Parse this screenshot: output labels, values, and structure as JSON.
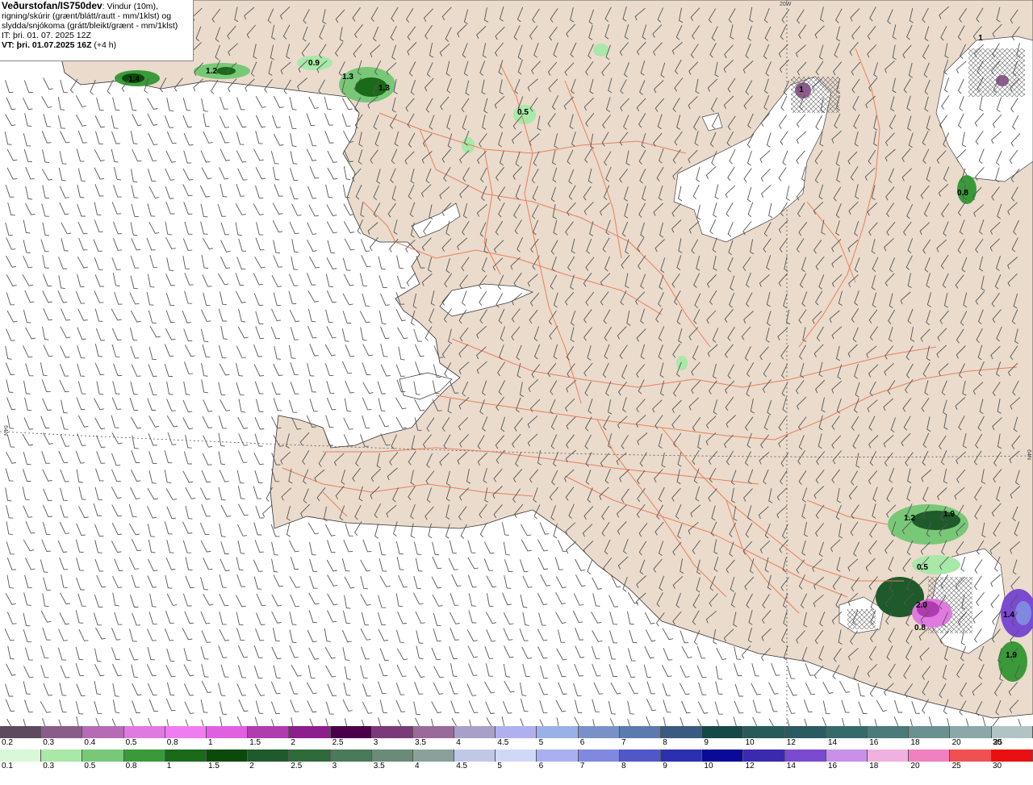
{
  "header": {
    "title": "Veðurstofan/IS750dev",
    "description_1": ": Vindur (10m),",
    "description_2": "rigning/skúrir (grænt/blátt/rautt - mm/1klst) og",
    "description_3": "slydda/snjókoma (grátt/bleikt/grænt - mm/1klst)",
    "initial_time": "IT: þri. 01. 07. 2025 12Z",
    "valid_time": "VT: þri. 01.07.2025 16Z",
    "lead_time": "(+4 h)"
  },
  "map": {
    "colors": {
      "land": "#eadbcc",
      "sea": "#ffffff",
      "roads": "#e8805a",
      "coast": "#333333",
      "barbs": "#555555",
      "glacier": "#ffffff"
    },
    "grid_labels": {
      "lon": "20W",
      "lat_left": "64N",
      "lat_right": "64N"
    },
    "precip_labels": [
      {
        "text": "1.4"
      },
      {
        "text": "1.2"
      },
      {
        "text": "0.9"
      },
      {
        "text": "1.3"
      },
      {
        "text": "1.3"
      },
      {
        "text": "0.5"
      },
      {
        "text": "1"
      },
      {
        "text": "0.8"
      },
      {
        "text": "1.2"
      },
      {
        "text": "1.9"
      },
      {
        "text": "0.5"
      },
      {
        "text": "2.0"
      },
      {
        "text": "0.8"
      },
      {
        "text": "1.9"
      },
      {
        "text": "1.4"
      },
      {
        "text": "1"
      }
    ]
  },
  "legend_snow": {
    "items": [
      {
        "label": "0.2",
        "color": "#5e4a5e"
      },
      {
        "label": "0.3",
        "color": "#8a5c8a"
      },
      {
        "label": "0.4",
        "color": "#b56cb5"
      },
      {
        "label": "0.5",
        "color": "#e07ae0"
      },
      {
        "label": "0.8",
        "color": "#f07cf0"
      },
      {
        "label": "1",
        "color": "#e060e0"
      },
      {
        "label": "1.5",
        "color": "#b03cb0"
      },
      {
        "label": "2",
        "color": "#8c1f8c"
      },
      {
        "label": "2.5",
        "color": "#4a004a"
      },
      {
        "label": "3",
        "color": "#7a3a7a"
      },
      {
        "label": "3.5",
        "color": "#9a6a9a"
      },
      {
        "label": "4",
        "color": "#a8a0c8"
      },
      {
        "label": "4.5",
        "color": "#b0b0f0"
      },
      {
        "label": "5",
        "color": "#9ab0e8"
      },
      {
        "label": "6",
        "color": "#7a90c8"
      },
      {
        "label": "7",
        "color": "#5a7ab0"
      },
      {
        "label": "8",
        "color": "#3a5a80"
      },
      {
        "label": "9",
        "color": "#164848"
      },
      {
        "label": "10",
        "color": "#285a5a"
      },
      {
        "label": "12",
        "color": "#2a5a62"
      },
      {
        "label": "14",
        "color": "#356a6a"
      },
      {
        "label": "16",
        "color": "#4a7a7a"
      },
      {
        "label": "18",
        "color": "#6a9090"
      },
      {
        "label": "20",
        "color": "#8aa8a8"
      },
      {
        "label": "25",
        "color": "#b0c4c4"
      },
      {
        "label": "30",
        "color": "#d8e0e0"
      }
    ]
  },
  "legend_rain": {
    "items": [
      {
        "label": "0.1",
        "color": "#d8f8d8"
      },
      {
        "label": "0.3",
        "color": "#a8e8a8"
      },
      {
        "label": "0.5",
        "color": "#78c878"
      },
      {
        "label": "0.8",
        "color": "#3a9a3a"
      },
      {
        "label": "1",
        "color": "#1a6a1a"
      },
      {
        "label": "1.5",
        "color": "#0a4a0a"
      },
      {
        "label": "2",
        "color": "#1e5a2a"
      },
      {
        "label": "2.5",
        "color": "#2e6a3a"
      },
      {
        "label": "3",
        "color": "#4a7a5a"
      },
      {
        "label": "3.5",
        "color": "#6a8a7a"
      },
      {
        "label": "4",
        "color": "#8aa09a"
      },
      {
        "label": "4.5",
        "color": "#c0c8e8"
      },
      {
        "label": "5",
        "color": "#d0d8f8"
      },
      {
        "label": "6",
        "color": "#a8b0f0"
      },
      {
        "label": "7",
        "color": "#8088e0"
      },
      {
        "label": "8",
        "color": "#5058c8"
      },
      {
        "label": "9",
        "color": "#2a30b0"
      },
      {
        "label": "10",
        "color": "#0a0a98"
      },
      {
        "label": "12",
        "color": "#3a2ab0"
      },
      {
        "label": "14",
        "color": "#7a4ad0"
      },
      {
        "label": "16",
        "color": "#c890e8"
      },
      {
        "label": "18",
        "color": "#f0b0e0"
      },
      {
        "label": "20",
        "color": "#f080c0"
      },
      {
        "label": "25",
        "color": "#f05050"
      },
      {
        "label": "30",
        "color": "#e81010"
      }
    ]
  }
}
